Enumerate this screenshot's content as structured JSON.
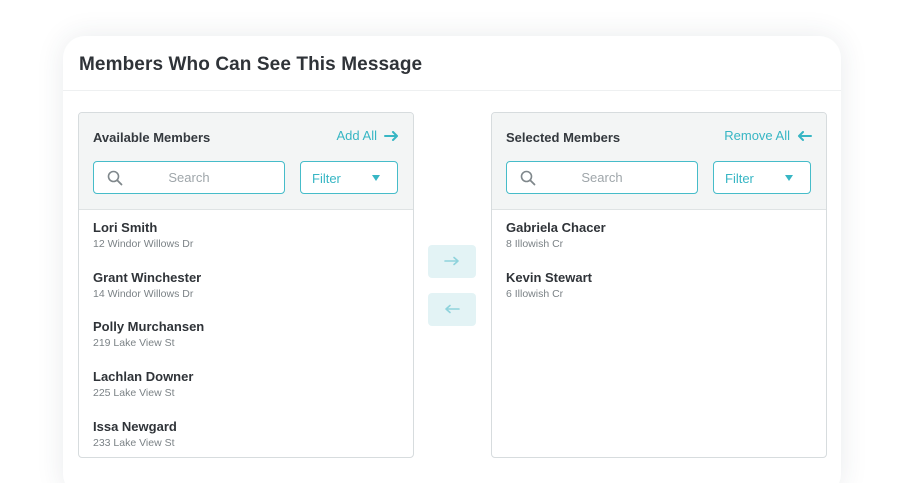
{
  "dialog": {
    "title": "Members Who Can See This Message"
  },
  "available": {
    "title": "Available Members",
    "action_label": "Add All",
    "action_icon": "arrow-right-icon",
    "search_placeholder": "Search",
    "filter_label": "Filter",
    "members": [
      {
        "name": "Lori Smith",
        "address": "12 Windor Willows Dr"
      },
      {
        "name": "Grant Winchester",
        "address": "14 Windor Willows Dr"
      },
      {
        "name": "Polly Murchansen",
        "address": "219 Lake View St"
      },
      {
        "name": "Lachlan Downer",
        "address": "225 Lake View St"
      },
      {
        "name": "Issa Newgard",
        "address": "233 Lake View St"
      }
    ]
  },
  "selected": {
    "title": "Selected Members",
    "action_label": "Remove All",
    "action_icon": "arrow-left-icon",
    "search_placeholder": "Search",
    "filter_label": "Filter",
    "members": [
      {
        "name": "Gabriela Chacer",
        "address": "8 Illowish Cr"
      },
      {
        "name": "Kevin Stewart",
        "address": "6 Illowish Cr"
      }
    ]
  },
  "transfer": {
    "move_right_icon": "arrow-right-icon",
    "move_left_icon": "arrow-left-icon"
  },
  "colors": {
    "accent": "#37b6c4",
    "accent_light": "#e3f3f5",
    "panel_header_bg": "#f3f5f5",
    "text_primary": "#2f3338",
    "text_secondary": "#7b8286"
  }
}
